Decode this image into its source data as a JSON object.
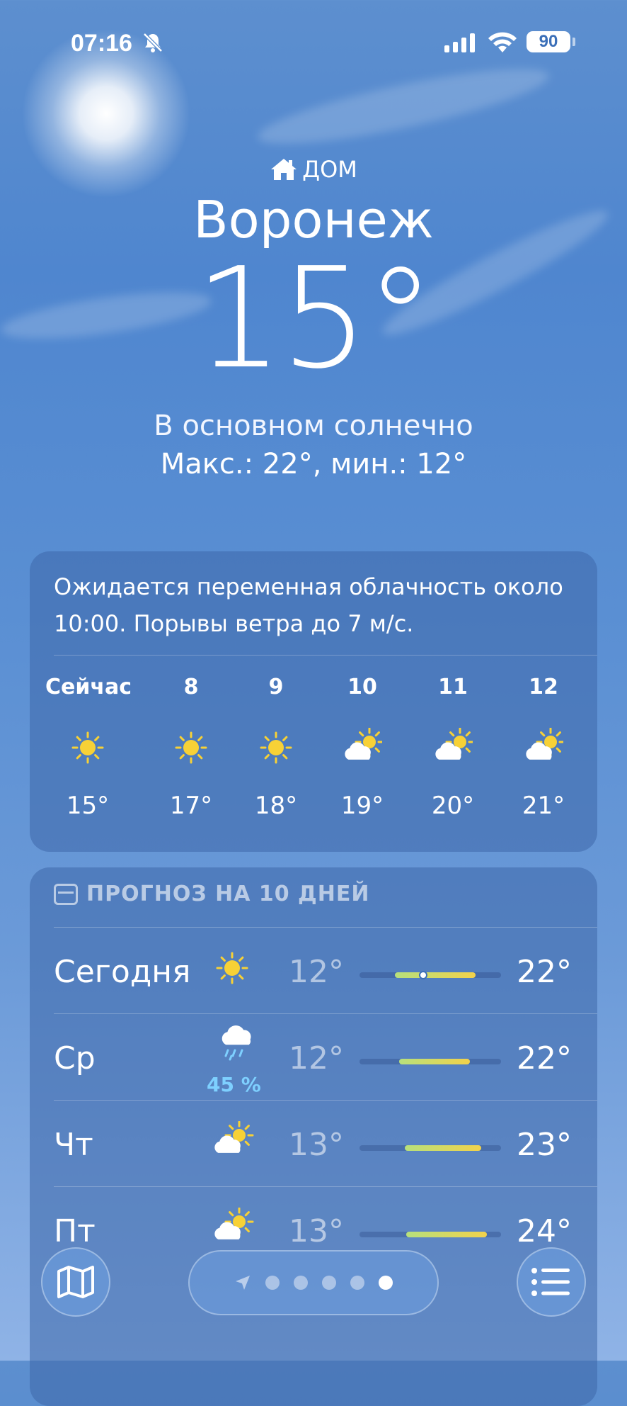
{
  "status_bar": {
    "time": "07:16",
    "battery": "90"
  },
  "header": {
    "home_label": "ДОМ",
    "city": "Воронеж",
    "temperature": "15°",
    "condition": "В основном солнечно",
    "hi_lo": "Макс.: 22°, мин.: 12°"
  },
  "hourly": {
    "summary": "Ожидается переменная облачность около 10:00. Порывы ветра до 7 м/с.",
    "items": [
      {
        "label": "Сейчас",
        "icon": "sun-icon",
        "temp": "15°"
      },
      {
        "label": "8",
        "icon": "sun-icon",
        "temp": "17°"
      },
      {
        "label": "9",
        "icon": "sun-icon",
        "temp": "18°"
      },
      {
        "label": "10",
        "icon": "partly-cloudy-icon",
        "temp": "19°"
      },
      {
        "label": "11",
        "icon": "partly-cloudy-icon",
        "temp": "20°"
      },
      {
        "label": "12",
        "icon": "partly-cloudy-icon",
        "temp": "21°"
      }
    ]
  },
  "daily": {
    "title": "ПРОГНОЗ НА 10 ДНЕЙ",
    "days": [
      {
        "name": "Сегодня",
        "icon": "sun-icon",
        "pop": "",
        "min": "12°",
        "max": "22°",
        "bar_start": 0.25,
        "bar_end": 0.82,
        "current": 0.45
      },
      {
        "name": "Ср",
        "icon": "rain-cloud-icon",
        "pop": "45 %",
        "min": "12°",
        "max": "22°",
        "bar_start": 0.28,
        "bar_end": 0.78
      },
      {
        "name": "Чт",
        "icon": "partly-cloudy-icon",
        "pop": "",
        "min": "13°",
        "max": "23°",
        "bar_start": 0.32,
        "bar_end": 0.86
      },
      {
        "name": "Пт",
        "icon": "partly-cloudy-icon",
        "pop": "",
        "min": "13°",
        "max": "24°",
        "bar_start": 0.33,
        "bar_end": 0.9
      }
    ]
  },
  "bottom": {
    "pages": 6,
    "active_page": 6
  },
  "colors": {
    "bar_low": "#b7e07c",
    "bar_high": "#f2d24b",
    "precip": "#7ed0ff"
  }
}
